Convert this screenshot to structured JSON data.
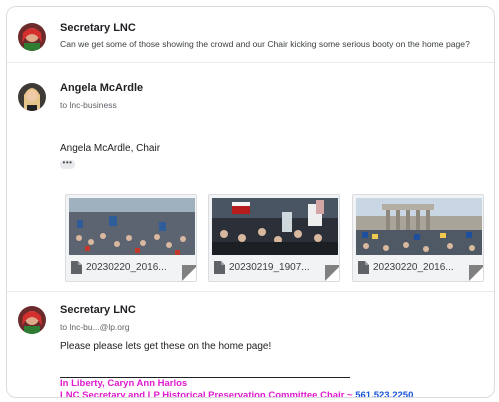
{
  "messages": [
    {
      "sender": "Secretary LNC",
      "snippet": "Can we get some of those showing the crowd and our Chair kicking some serious booty on the home page?"
    },
    {
      "sender": "Angela McArdle",
      "recipients": "to lnc-business",
      "body_line": "Angela McArdle, Chair",
      "trimmed_label": "•••",
      "attachments": [
        {
          "filename": "20230220_2016..."
        },
        {
          "filename": "20230219_1907..."
        },
        {
          "filename": "20230220_2016..."
        }
      ]
    },
    {
      "sender": "Secretary LNC",
      "recipients": "to lnc-bu...@lp.org",
      "body_line": "Please please lets get these on the home page!",
      "signature": {
        "line1": "In Liberty, Caryn Ann Harlos",
        "line2": "LNC Secretary and LP Historical Preservation Committee Chair ~ ",
        "phone": "561.523.2250"
      }
    }
  ],
  "colors": {
    "signature_magenta": "#e01bd0",
    "phone_blue": "#1a56db",
    "avatar_red": "#c62828"
  }
}
